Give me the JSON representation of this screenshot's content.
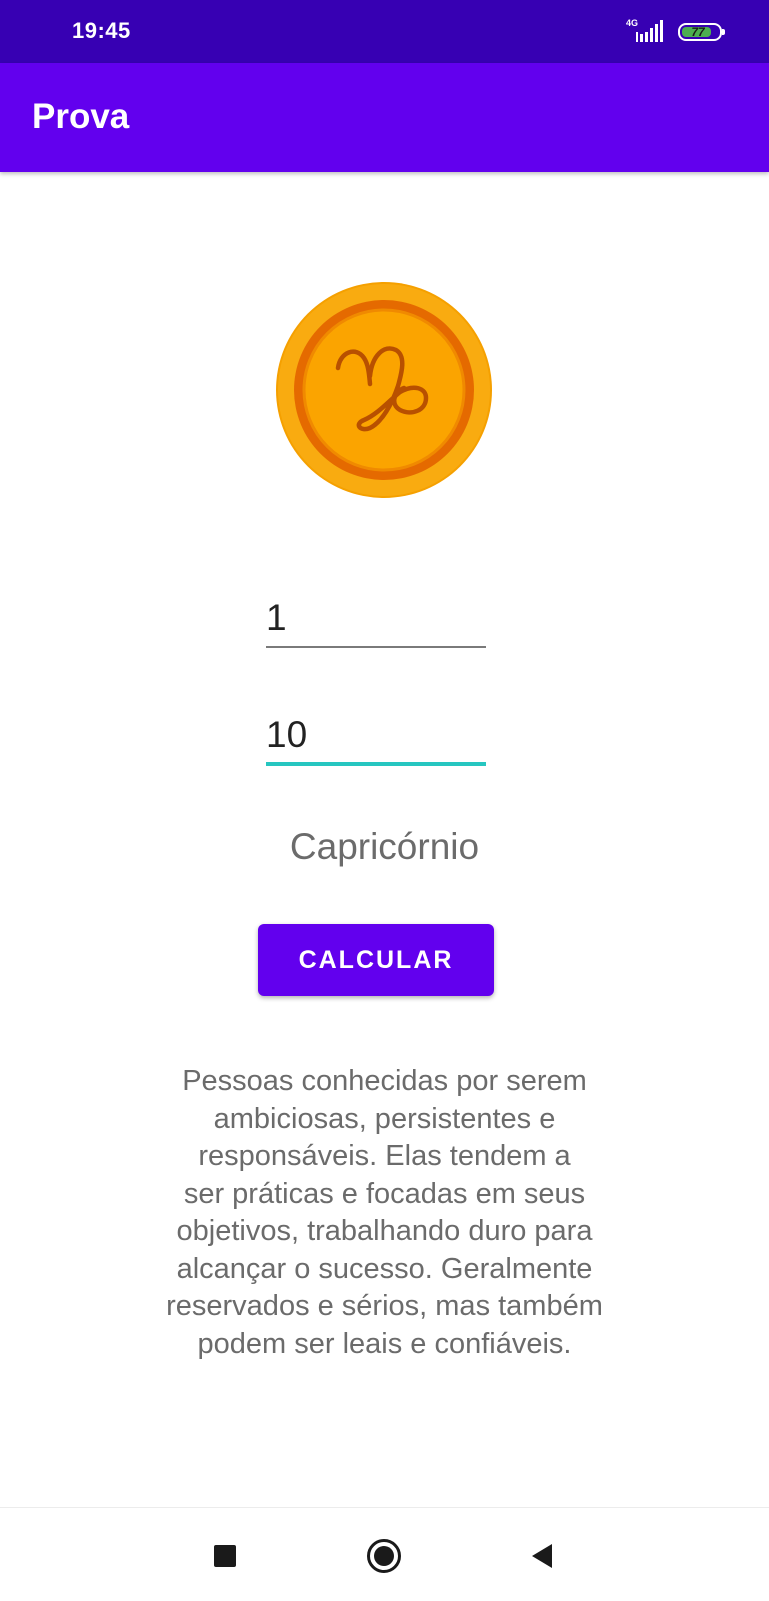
{
  "status_bar": {
    "time": "19:45",
    "network": "4G",
    "battery": "77",
    "battery_color": "#4caf50",
    "background": "#3700b3"
  },
  "app_bar": {
    "title": "Prova",
    "background": "#6200ee"
  },
  "zodiac_image": {
    "icon": "capricorn-symbol-coin",
    "colors": {
      "outer": "#f7a800",
      "ring": "#e86e00",
      "inner": "#fba400",
      "glyph": "#b85000"
    }
  },
  "form": {
    "day_value": "1",
    "month_value": "10",
    "focus_color": "#26c6c0"
  },
  "result": {
    "sign_name": "Capricórnio",
    "button_label": "CALCULAR",
    "description_lines": [
      "Pessoas conhecidas por serem",
      "ambiciosas, persistentes e",
      "responsáveis. Elas tendem a",
      "ser práticas e focadas em seus",
      "objetivos, trabalhando duro para",
      "alcançar o sucesso. Geralmente",
      "reservados e sérios, mas também",
      "podem ser leais e confiáveis."
    ]
  },
  "nav_bar": {
    "items": [
      "recents-icon",
      "home-icon",
      "back-icon"
    ]
  }
}
